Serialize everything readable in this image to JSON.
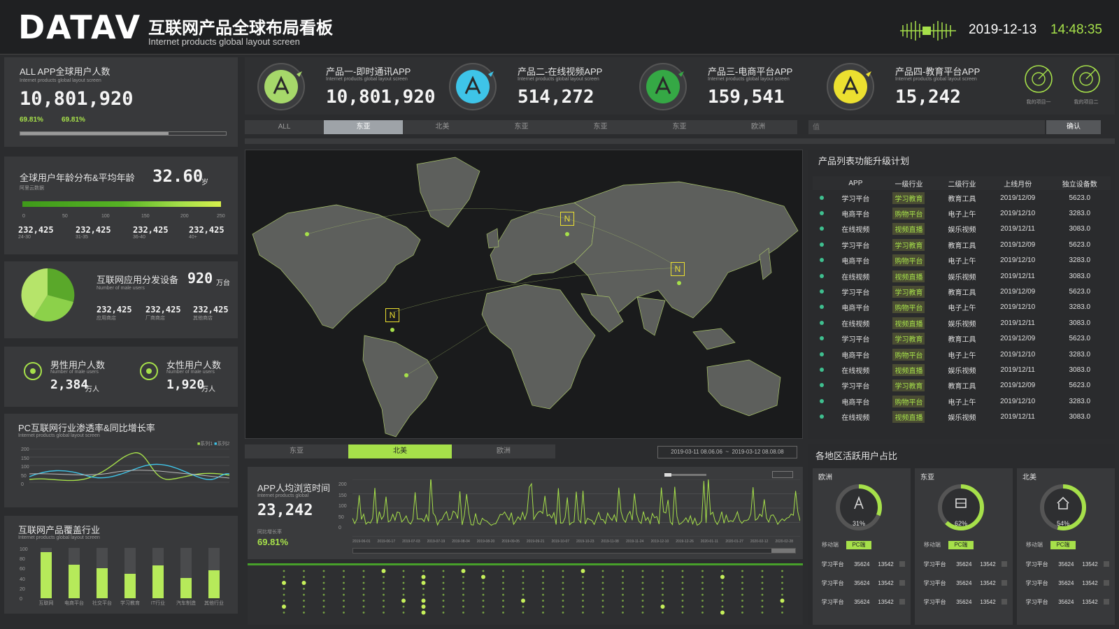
{
  "header": {
    "logo": "DATAV",
    "title": "互联网产品全球布局看板",
    "subtitle": "Internet products global layout screen",
    "date": "2019-12-13",
    "time": "14:48:35"
  },
  "left": {
    "all_users": {
      "title": "ALL APP全球用户人数",
      "sub": "Internet products global layout screen",
      "value": "10,801,920",
      "pct1": "69.81%",
      "pct2": "69.81%",
      "progress": 0.72
    },
    "age": {
      "title": "全球用户年龄分布&平均年龄",
      "sub": "阿里云数据",
      "avg": "32.60",
      "unit": "岁",
      "ticks": [
        "0",
        "50",
        "100",
        "150",
        "200",
        "250"
      ],
      "items": [
        {
          "value": "232,425",
          "label": "24-30"
        },
        {
          "value": "232,425",
          "label": "31-35"
        },
        {
          "value": "232,425",
          "label": "36-40"
        },
        {
          "value": "232,425",
          "label": "40+"
        }
      ]
    },
    "devices": {
      "title": "互联网应用分发设备",
      "sub": "Number of male users",
      "value": "920",
      "unit": "万台",
      "items": [
        {
          "value": "232,425",
          "label": "应用商店"
        },
        {
          "value": "232,425",
          "label": "厂商商店"
        },
        {
          "value": "232,425",
          "label": "其他商店"
        }
      ]
    },
    "gender": {
      "male": {
        "title": "男性用户人数",
        "sub": "Number of male users",
        "value": "2,384",
        "unit": "万人"
      },
      "female": {
        "title": "女性用户人数",
        "sub": "Number of male users",
        "value": "1,920",
        "unit": "万人"
      }
    },
    "pc": {
      "title": "PC互联网行业渗透率&同比增长率",
      "sub": "Internet products global layout screen",
      "legend": [
        "系列1",
        "系列2"
      ],
      "yticks": [
        "200",
        "150",
        "100",
        "50",
        "0"
      ]
    },
    "coverage": {
      "title": "互联网产品覆盖行业",
      "sub": "Internet products global layout screen",
      "values": [
        92,
        67,
        60,
        48,
        65,
        40,
        55
      ],
      "labels": [
        "互联网",
        "电商平台",
        "社交平台",
        "学习教育",
        "IT行业",
        "汽车制造",
        "其他行业"
      ],
      "yticks": [
        "100",
        "80",
        "60",
        "40",
        "20",
        "0"
      ]
    }
  },
  "products": [
    {
      "title": "产品一-即时通讯APP",
      "sub": "Internet products global layout screen",
      "value": "10,801,920",
      "color": "#a6d86a"
    },
    {
      "title": "产品二-在线视频APP",
      "sub": "Internet products global layout screen",
      "value": "514,272",
      "color": "#3ec4e8"
    },
    {
      "title": "产品三-电商平台APP",
      "sub": "Internet products global layout screen",
      "value": "159,541",
      "color": "#35a845"
    },
    {
      "title": "产品四-教育平台APP",
      "sub": "Internet products global layout screen",
      "value": "15,242",
      "color": "#ece030"
    }
  ],
  "side_buttons": [
    "我的项目一",
    "我的项目二"
  ],
  "region_tabs": [
    "ALL",
    "东亚",
    "北美",
    "东亚",
    "东亚",
    "东亚",
    "欧洲"
  ],
  "search": {
    "placeholder": "值",
    "button": "确认"
  },
  "map": {
    "markers": [
      "N",
      "N",
      "N"
    ]
  },
  "map_tabs": [
    "东亚",
    "北美",
    "欧洲"
  ],
  "date_range": "2019-03-11 08.06.06  ~  2019-03-12 08.08.08",
  "browse": {
    "title": "APP人均浏览时间",
    "sub": "Internet products global",
    "value": "23,242",
    "yoy_label": "同比增长率",
    "yoy": "69.81%",
    "yticks": [
      "200",
      "150",
      "100",
      "50",
      "0"
    ],
    "xticks": [
      "2019-06-01",
      "2019-06-17",
      "2019-07-03",
      "2019-07-19",
      "2019-08-04",
      "2019-08-20",
      "2019-09-05",
      "2019-09-21",
      "2019-10-07",
      "2019-10-23",
      "2019-11-08",
      "2019-11-24",
      "2019-12-10",
      "2019-12-26",
      "2020-01-11",
      "2020-01-27",
      "2020-02-12",
      "2020-02-28"
    ]
  },
  "plan": {
    "title": "产品列表功能升级计划",
    "headers": [
      "APP",
      "一级行业",
      "二级行业",
      "上线月份",
      "独立设备数"
    ],
    "rows": [
      [
        "学习平台",
        "学习教育",
        "教育工具",
        "2019/12/09",
        "5623.0"
      ],
      [
        "电商平台",
        "购物平台",
        "电子上午",
        "2019/12/10",
        "3283.0"
      ],
      [
        "在线视频",
        "视频直播",
        "娱乐视频",
        "2019/12/11",
        "3083.0"
      ],
      [
        "学习平台",
        "学习教育",
        "教育工具",
        "2019/12/09",
        "5623.0"
      ],
      [
        "电商平台",
        "购物平台",
        "电子上午",
        "2019/12/10",
        "3283.0"
      ],
      [
        "在线视频",
        "视频直播",
        "娱乐视频",
        "2019/12/11",
        "3083.0"
      ],
      [
        "学习平台",
        "学习教育",
        "教育工具",
        "2019/12/09",
        "5623.0"
      ],
      [
        "电商平台",
        "购物平台",
        "电子上午",
        "2019/12/10",
        "3283.0"
      ],
      [
        "在线视频",
        "视频直播",
        "娱乐视频",
        "2019/12/11",
        "3083.0"
      ],
      [
        "学习平台",
        "学习教育",
        "教育工具",
        "2019/12/09",
        "5623.0"
      ],
      [
        "电商平台",
        "购物平台",
        "电子上午",
        "2019/12/10",
        "3283.0"
      ],
      [
        "在线视频",
        "视频直播",
        "娱乐视频",
        "2019/12/11",
        "3083.0"
      ],
      [
        "学习平台",
        "学习教育",
        "教育工具",
        "2019/12/09",
        "5623.0"
      ],
      [
        "电商平台",
        "购物平台",
        "电子上午",
        "2019/12/10",
        "3283.0"
      ],
      [
        "在线视频",
        "视频直播",
        "娱乐视频",
        "2019/12/11",
        "3083.0"
      ]
    ]
  },
  "active": {
    "title": "各地区活跃用户占比",
    "regions": [
      {
        "name": "欧洲",
        "pct": "31%",
        "value": 0.31,
        "icon": "person-icon"
      },
      {
        "name": "东亚",
        "pct": "62%",
        "value": 0.62,
        "icon": "building-icon"
      },
      {
        "name": "北美",
        "pct": "54%",
        "value": 0.54,
        "icon": "house-icon"
      }
    ],
    "toggle": [
      "移动端",
      "PC端"
    ],
    "rows": [
      [
        "学习平台",
        "35624",
        "13542"
      ],
      [
        "学习平台",
        "35624",
        "13542"
      ],
      [
        "学习平台",
        "35624",
        "13542"
      ]
    ]
  }
}
